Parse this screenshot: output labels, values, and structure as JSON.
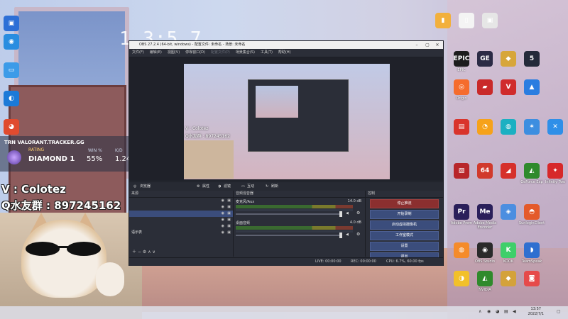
{
  "desktop": {
    "clock": "1 3:5 7",
    "left_icons": [
      {
        "label": "",
        "color": "#2d6fd6",
        "glyph": "▣"
      },
      {
        "label": "",
        "color": "#2a8de0",
        "glyph": "◉"
      },
      {
        "label": "",
        "color": "#3c9be8",
        "glyph": "▭"
      },
      {
        "label": "",
        "color": "#1b7ad8",
        "glyph": "◐"
      },
      {
        "label": "",
        "color": "#e04b2f",
        "glyph": "◕"
      }
    ],
    "right_icons_rows": [
      [
        {
          "label": "",
          "color": "#f2b03c",
          "glyph": "▮"
        },
        {
          "label": "",
          "color": "#f4f4f4",
          "glyph": "▯"
        },
        {
          "label": "",
          "color": "#e6e6e6",
          "glyph": "▣"
        }
      ],
      [
        {
          "label": "EPIC",
          "color": "#1d1d1d",
          "glyph": "EPIC"
        },
        {
          "label": "",
          "color": "#2b2b45",
          "glyph": "GE"
        },
        {
          "label": "",
          "color": "#d7a63a",
          "glyph": "◆"
        },
        {
          "label": "",
          "color": "#242a3a",
          "glyph": "5"
        }
      ],
      [
        {
          "label": "Origin",
          "color": "#f56c2d",
          "glyph": "◎"
        },
        {
          "label": "",
          "color": "#c92a2a",
          "glyph": "▰"
        },
        {
          "label": "",
          "color": "#d02c2c",
          "glyph": "V"
        },
        {
          "label": "",
          "color": "#2a7de0",
          "glyph": "▲"
        }
      ],
      [
        {
          "label": "",
          "color": "#d9342c",
          "glyph": "▤"
        },
        {
          "label": "",
          "color": "#f6a21a",
          "glyph": "◔"
        },
        {
          "label": "",
          "color": "#1bb0c2",
          "glyph": "◍"
        },
        {
          "label": "",
          "color": "#3d8ee0",
          "glyph": "✶"
        },
        {
          "label": "",
          "color": "#2f8fe8",
          "glyph": "✕"
        }
      ],
      [
        {
          "label": "",
          "color": "#b8262a",
          "glyph": "▧"
        },
        {
          "label": "",
          "color": "#d13a2c",
          "glyph": "64"
        },
        {
          "label": "",
          "color": "#d6302a",
          "glyph": "◢"
        },
        {
          "label": "GeForce Exp",
          "color": "#2f8a2c",
          "glyph": "◭"
        },
        {
          "label": "Infinity Two",
          "color": "#d7282a",
          "glyph": "✦"
        }
      ],
      [
        {
          "label": "Adobe Prem",
          "color": "#2a1f5a",
          "glyph": "Pr"
        },
        {
          "label": "Adobe Media Encoder",
          "color": "#2a1f5a",
          "glyph": "Me"
        },
        {
          "label": "",
          "color": "#4c8ee0",
          "glyph": "◈"
        },
        {
          "label": "SunloginClient",
          "color": "#e45a2a",
          "glyph": "◓"
        }
      ],
      [
        {
          "label": "",
          "color": "#f58b2a",
          "glyph": "◍"
        },
        {
          "label": "OBS Studio",
          "color": "#2a2a2a",
          "glyph": "◉"
        },
        {
          "label": "KOOK",
          "color": "#3ecf6a",
          "glyph": "K"
        },
        {
          "label": "TeamSpeak",
          "color": "#2f6fd0",
          "glyph": "◗"
        }
      ],
      [
        {
          "label": "",
          "color": "#f2c02a",
          "glyph": "◑"
        },
        {
          "label": "NVIDIA",
          "color": "#2f8a2c",
          "glyph": "◭"
        },
        {
          "label": "",
          "color": "#d4a23a",
          "glyph": "◆"
        },
        {
          "label": "",
          "color": "#e64a4a",
          "glyph": "◙"
        }
      ]
    ]
  },
  "tracker": {
    "brand": "TRN   VALORANT.TRACKER.GG",
    "rating_label": "RATING",
    "rank": "DIAMOND 1",
    "winrate_label": "WIN %",
    "winrate": "55%",
    "kd_label": "K/D",
    "kd": "1.24"
  },
  "overlay_text": {
    "line1": "V : Colotez",
    "line2": "Q水友群 : 897245162"
  },
  "obs": {
    "title": "OBS 27.2.4 (64-bit, windows) - 配置文件: 未命名 - 场景: 未命名",
    "menu": [
      "文件(F)",
      "编辑(E)",
      "视图(V)",
      "停靠窗口(D)",
      "配置文件(P)",
      "场景集合(S)",
      "工具(T)",
      "帮助(H)"
    ],
    "preview_overlay": {
      "line1": "V : Colotez",
      "line2": "Q水友群 : 897245162"
    },
    "dock_bar": {
      "source_name": "浏览器",
      "properties": "属性",
      "filters": "滤镜",
      "interact": "互动",
      "refresh": "刷新"
    },
    "scenes_header": "来源",
    "sources": [
      "",
      "",
      "",
      "",
      "",
      "语示表"
    ],
    "mixer_header": "音频混音器",
    "mixer": [
      {
        "name": "麦克风/Aux",
        "db": "14.0 dB"
      },
      {
        "name": "桌面音频",
        "db": "4.0 dB"
      }
    ],
    "controls_header": "控制",
    "controls": [
      "停止推流",
      "开始录制",
      "启动虚拟摄像机",
      "工作室模式",
      "设置",
      "退出"
    ],
    "status": {
      "live": "LIVE: 00:00:00",
      "rec": "REC: 00:00:00",
      "cpu": "CPU: 6.7%, 60.00 fps"
    }
  },
  "taskbar": {
    "time": "13:57",
    "date": "2022/7/1"
  }
}
